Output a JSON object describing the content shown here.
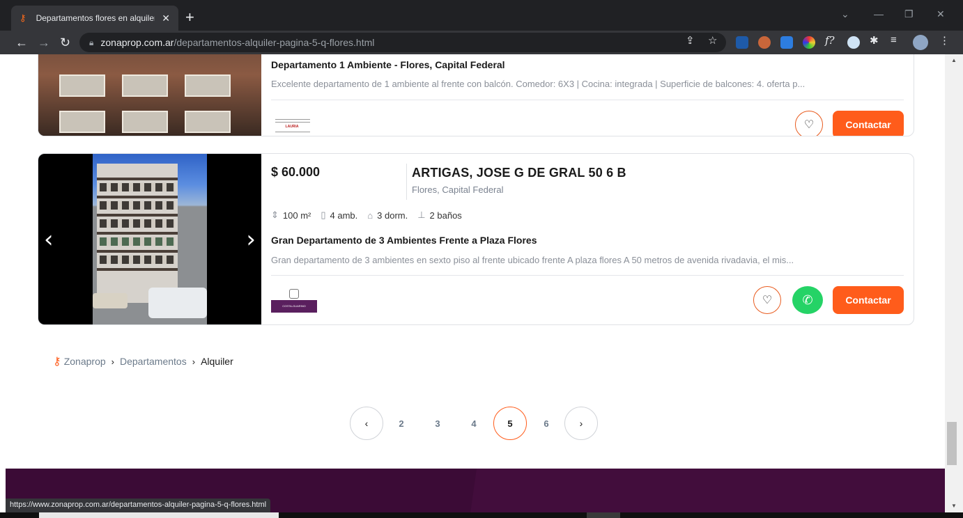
{
  "browser": {
    "tab_title": "Departamentos flores en alquiler",
    "tab_close": "✕",
    "new_tab": "+",
    "url_host": "zonaprop.com.ar",
    "url_path": "/departamentos-alquiler-pagina-5-q-flores.html",
    "status_url": "https://www.zonaprop.com.ar/departamentos-alquiler-pagina-5-q-flores.html"
  },
  "listing_prev": {
    "title": "Departamento 1 Ambiente - Flores, Capital Federal",
    "description": "Excelente departamento de 1 ambiente al frente con balcón. Comedor: 6X3 | Cocina: integrada | Superficie de balcones: 4. oferta p...",
    "agency_logo_text": "LAURIA",
    "contact_label": "Contactar"
  },
  "listing": {
    "price": "$ 60.000",
    "address": "ARTIGAS, JOSE G DE GRAL 50 6 B",
    "location": "Flores, Capital Federal",
    "features": [
      {
        "icon": "surface-icon",
        "glyph": "⇕",
        "value": "100 m²"
      },
      {
        "icon": "rooms-icon",
        "glyph": "▯",
        "value": "4 amb."
      },
      {
        "icon": "bed-icon",
        "glyph": "⌂",
        "value": "3 dorm."
      },
      {
        "icon": "bath-icon",
        "glyph": "⊥",
        "value": "2 baños"
      }
    ],
    "title": "Gran Departamento de 3 Ambientes Frente a Plaza Flores",
    "description": "Gran departamento de 3 ambientes en sexto piso al frente ubicado frente A plaza flores A 50 metros de avenida rivadavia, el mis...",
    "agency_logo_text": "COSTA-GUARINO",
    "contact_label": "Contactar"
  },
  "breadcrumb": {
    "items": [
      "Zonaprop",
      "Departamentos",
      "Alquiler"
    ]
  },
  "pagination": {
    "pages": [
      "2",
      "3",
      "4",
      "5",
      "6"
    ],
    "current": "5"
  },
  "colors": {
    "accent": "#ff5c1b",
    "whatsapp": "#25d366",
    "footer": "#3b0b36"
  }
}
